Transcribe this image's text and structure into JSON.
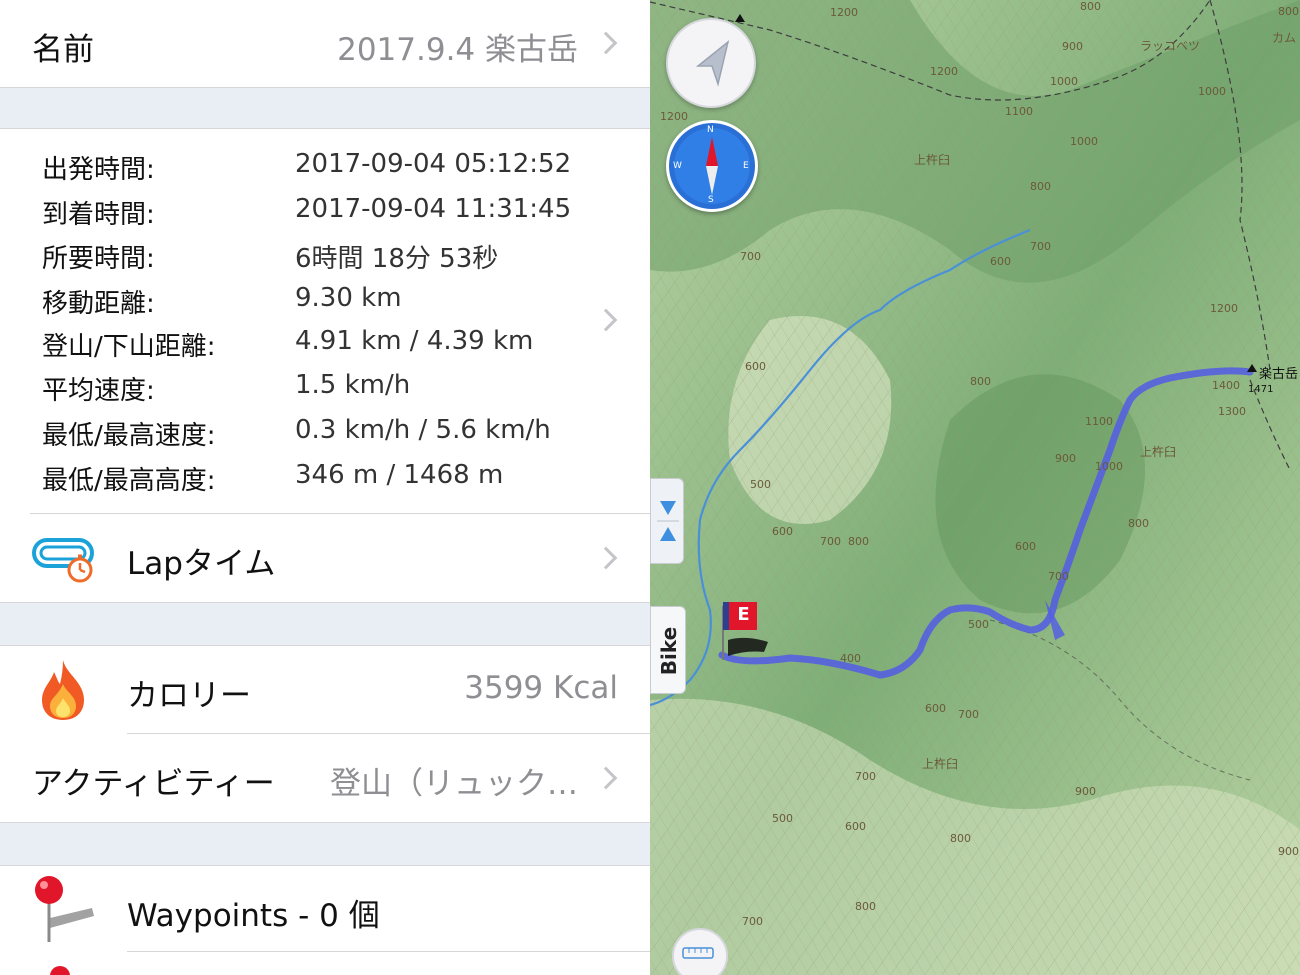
{
  "name_row": {
    "label": "名前",
    "value": "2017.9.4 楽古岳"
  },
  "stats": [
    {
      "label": "出発時間:",
      "value": "2017-09-04 05:12:52"
    },
    {
      "label": "到着時間:",
      "value": "2017-09-04 11:31:45"
    },
    {
      "label": "所要時間:",
      "value": "6時間 18分 53秒"
    },
    {
      "label": "移動距離:",
      "value": "9.30 km"
    },
    {
      "label": "登山/下山距離:",
      "value": "4.91 km / 4.39 km"
    },
    {
      "label": "平均速度:",
      "value": "1.5 km/h"
    },
    {
      "label": "最低/最高速度:",
      "value": "0.3 km/h / 5.6 km/h"
    },
    {
      "label": "最低/最高高度:",
      "value": "346 m / 1468 m"
    }
  ],
  "lap_row": {
    "label": "Lapタイム"
  },
  "calorie_row": {
    "label": "カロリー",
    "value": "3599 Kcal"
  },
  "activity_row": {
    "label": "アクティビティー",
    "value": "登山（リュック…"
  },
  "waypoints_row": {
    "label": "Waypoints - 0 個"
  },
  "map": {
    "mode_tab": "Bike",
    "end_flag": "E",
    "peak_name": "楽古岳",
    "peak_elevation": "1471",
    "place_labels": [
      "ラッコベツ",
      "カム",
      "上杵臼",
      "上杵臼",
      "上杵臼"
    ],
    "contours": [
      "1200",
      "1200",
      "1100",
      "1000",
      "900",
      "800",
      "1000",
      "800",
      "1200",
      "700",
      "600",
      "700",
      "800",
      "600",
      "1100",
      "900",
      "1000",
      "800",
      "500",
      "600",
      "700",
      "800",
      "600",
      "700",
      "500",
      "400",
      "600",
      "700",
      "700",
      "600",
      "500",
      "900",
      "800",
      "700",
      "1200",
      "1400",
      "1300",
      "900",
      "800",
      "1000",
      "800"
    ],
    "route_color": "#5560e0",
    "compass_letters": {
      "n": "N",
      "s": "S",
      "e": "E",
      "w": "W"
    }
  }
}
